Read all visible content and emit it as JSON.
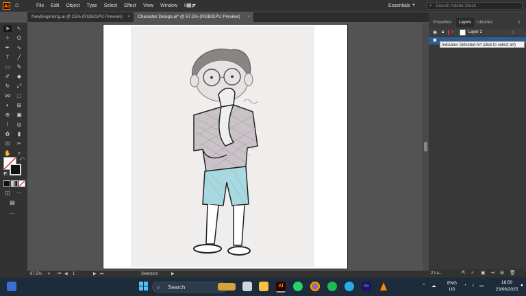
{
  "menubar": {
    "app_logo": "Ai",
    "items": [
      "File",
      "Edit",
      "Object",
      "Type",
      "Select",
      "Effect",
      "View",
      "Window",
      "Help"
    ],
    "workspace": "Essentials",
    "search_placeholder": "Search Adobe Stock"
  },
  "tabs": [
    {
      "label": "NewBeginning.ai @ 25% (RGB/GPU Preview)",
      "active": false
    },
    {
      "label": "Character Design.ai* @ 67.5% (RGB/GPU Preview)",
      "active": true
    }
  ],
  "status": {
    "zoom": "67.5%",
    "artboard": "1",
    "tool": "Selection"
  },
  "panel": {
    "tabs": [
      "Properties",
      "Layers",
      "Libraries"
    ],
    "active_tab": "Layers",
    "layers": [
      {
        "name": "Layer 2"
      }
    ],
    "tooltip": "Indicates Selected Art (click to select art)",
    "layer_count": "2 La..."
  },
  "taskbar": {
    "search_placeholder": "Search",
    "lang_top": "ENG",
    "lang_bottom": "US",
    "time": "18:50",
    "date": "23/06/2025"
  },
  "colors": {
    "accent": "#2f5b93",
    "shorts": "#a8d8e0",
    "shirt": "#c9c3c8"
  }
}
